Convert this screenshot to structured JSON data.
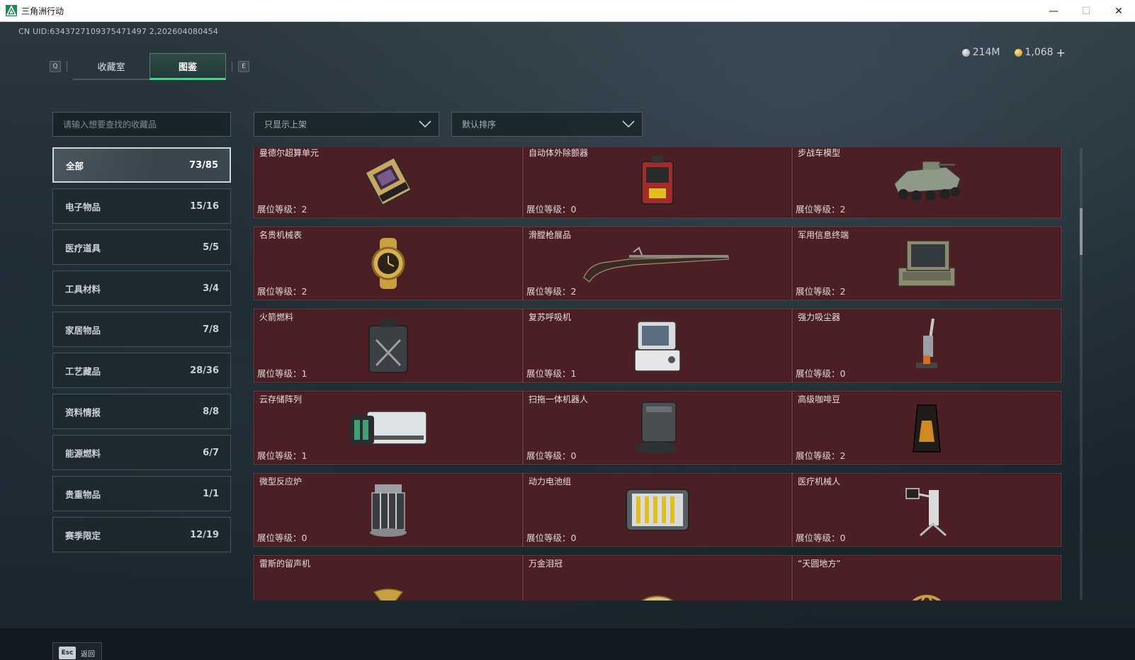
{
  "window": {
    "title": "三角洲行动",
    "controls": [
      "—",
      "☐",
      "✕"
    ]
  },
  "header": {
    "uid": "CN UID:6343727109375471497 2,202604080454",
    "tab_key_left": "Q",
    "tab_key_right": "E",
    "tabs": [
      {
        "label": "收藏室"
      },
      {
        "label": "图鉴"
      }
    ],
    "currency": {
      "silver": "214M",
      "gold": "1,068",
      "add": "+"
    }
  },
  "search": {
    "placeholder": "请输入想要查找的收藏品"
  },
  "filters": {
    "shelf_filter": "只显示上架",
    "sort": "默认排序"
  },
  "categories": [
    {
      "label": "全部",
      "count": "73/85"
    },
    {
      "label": "电子物品",
      "count": "15/16"
    },
    {
      "label": "医疗道具",
      "count": "5/5"
    },
    {
      "label": "工具材料",
      "count": "3/4"
    },
    {
      "label": "家居物品",
      "count": "7/8"
    },
    {
      "label": "工艺藏品",
      "count": "28/36"
    },
    {
      "label": "资料情报",
      "count": "8/8"
    },
    {
      "label": "能源燃料",
      "count": "6/7"
    },
    {
      "label": "贵重物品",
      "count": "1/1"
    },
    {
      "label": "赛季限定",
      "count": "12/19"
    }
  ],
  "level_prefix": "展位等级：",
  "items": [
    {
      "name": "曼德尔超算单元",
      "level": "展位等级：2",
      "icon": "supercomputer-unit-icon"
    },
    {
      "name": "自动体外除颤器",
      "level": "展位等级：0",
      "icon": "defibrillator-icon"
    },
    {
      "name": "步战车模型",
      "level": "展位等级：2",
      "icon": "armored-vehicle-model-icon"
    },
    {
      "name": "名贵机械表",
      "level": "展位等级：2",
      "icon": "luxury-watch-icon"
    },
    {
      "name": "滑膛枪展品",
      "level": "展位等级：2",
      "icon": "musket-icon"
    },
    {
      "name": "军用信息终端",
      "level": "展位等级：2",
      "icon": "military-terminal-icon"
    },
    {
      "name": "火箭燃料",
      "level": "展位等级：1",
      "icon": "fuel-canister-icon"
    },
    {
      "name": "复苏呼吸机",
      "level": "展位等级：1",
      "icon": "ventilator-icon"
    },
    {
      "name": "强力吸尘器",
      "level": "展位等级：0",
      "icon": "vacuum-cleaner-icon"
    },
    {
      "name": "云存储阵列",
      "level": "展位等级：1",
      "icon": "storage-array-icon"
    },
    {
      "name": "扫拖一体机器人",
      "level": "展位等级：0",
      "icon": "robot-vacuum-icon"
    },
    {
      "name": "高级咖啡豆",
      "level": "展位等级：2",
      "icon": "coffee-bag-icon"
    },
    {
      "name": "微型反应炉",
      "level": "展位等级：0",
      "icon": "micro-reactor-icon"
    },
    {
      "name": "动力电池组",
      "level": "展位等级：0",
      "icon": "battery-pack-icon"
    },
    {
      "name": "医疗机械人",
      "level": "展位等级：0",
      "icon": "medical-robot-icon"
    },
    {
      "name": "雷斯的留声机",
      "level": "",
      "icon": "gramophone-icon"
    },
    {
      "name": "万金泪冠",
      "level": "",
      "icon": "jeweled-crown-icon"
    },
    {
      "name": "“天圆地方”",
      "level": "",
      "icon": "armillary-sphere-icon"
    }
  ],
  "footer": {
    "esc_key": "Esc",
    "back_label": "返回"
  }
}
